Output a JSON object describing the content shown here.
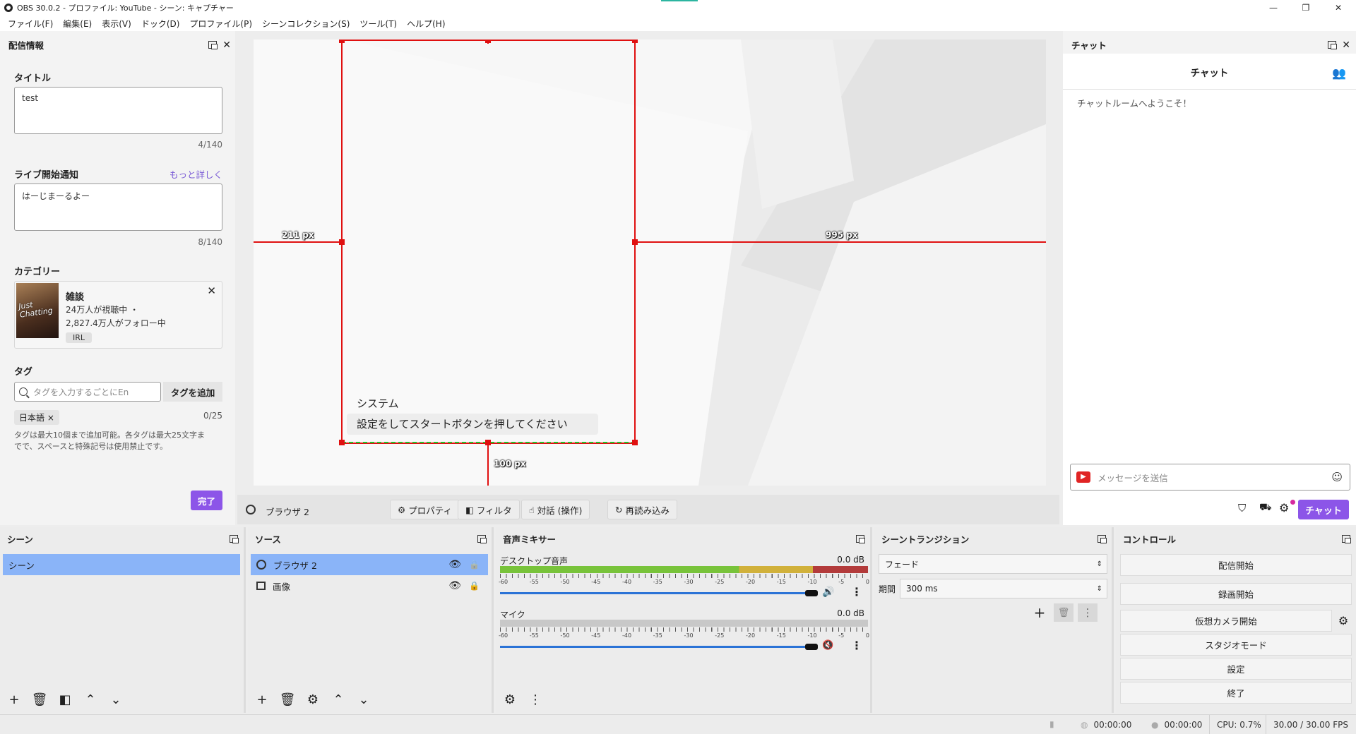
{
  "window": {
    "title": "OBS 30.0.2 - プロファイル: YouTube - シーン: キャプチャー",
    "minimize": "—",
    "maximize": "❐",
    "close": "✕"
  },
  "menu": [
    "ファイル(F)",
    "編集(E)",
    "表示(V)",
    "ドック(D)",
    "プロファイル(P)",
    "シーンコレクション(S)",
    "ツール(T)",
    "ヘルプ(H)"
  ],
  "stream_info": {
    "panel_title": "配信情報",
    "title_label": "タイトル",
    "title_value": "test",
    "title_counter": "4/140",
    "notification_label": "ライブ開始通知",
    "learn_more": "もっと詳しく",
    "notification_value": "はーじまーるよー",
    "notification_counter": "8/140",
    "category_label": "カテゴリー",
    "category": {
      "thumb_text": "Just Chatting",
      "name": "雑談",
      "viewers": "24万人が視聴中",
      "viewers_dot": "・",
      "followers": "2,827.4万人がフォロー中",
      "tag": "IRL"
    },
    "tags_label": "タグ",
    "tag_placeholder": "タグを入力するごとにEn",
    "tag_add_button": "タグを追加",
    "tag_chip": "日本語 ×",
    "tag_counter": "0/25",
    "tag_help": "タグは最大10個まで追加可能。各タグは最大25文字までで、スペースと特殊記号は使用禁止です。",
    "done_button": "完了"
  },
  "preview": {
    "label_left": "211 px",
    "label_right": "995 px",
    "label_bottom": "100 px",
    "overlay_title": "システム",
    "overlay_message": "設定をしてスタートボタンを押してください"
  },
  "source_toolbar": {
    "source_name": "ブラウザ 2",
    "properties": "プロパティ",
    "filters": "フィルタ",
    "interact": "対話 (操作)",
    "reload": "再読み込み"
  },
  "chat": {
    "panel_title": "チャット",
    "inner_title": "チャット",
    "welcome": "チャットルームへようこそ！",
    "input_placeholder": "メッセージを送信",
    "send_button": "チャット"
  },
  "scenes": {
    "title": "シーン",
    "items": [
      "シーン"
    ]
  },
  "sources": {
    "title": "ソース",
    "items": [
      {
        "name": "ブラウザ 2",
        "type": "browser",
        "selected": true
      },
      {
        "name": "画像",
        "type": "image",
        "selected": false
      }
    ]
  },
  "mixer": {
    "title": "音声ミキサー",
    "channels": [
      {
        "name": "デスクトップ音声",
        "db": "0.0 dB",
        "muted": false
      },
      {
        "name": "マイク",
        "db": "0.0 dB",
        "muted": true
      }
    ],
    "tick_labels": [
      "-60",
      "-55",
      "-50",
      "-45",
      "-40",
      "-35",
      "-30",
      "-25",
      "-20",
      "-15",
      "-10",
      "-5",
      "0"
    ]
  },
  "transitions": {
    "title": "シーントランジション",
    "selected": "フェード",
    "duration_label": "期間",
    "duration_value": "300 ms"
  },
  "controls": {
    "title": "コントロール",
    "start_streaming": "配信開始",
    "start_recording": "録画開始",
    "start_virtual_camera": "仮想カメラ開始",
    "studio_mode": "スタジオモード",
    "settings": "設定",
    "exit": "終了"
  },
  "status": {
    "stream_time": "00:00:00",
    "record_time": "00:00:00",
    "cpu": "CPU: 0.7%",
    "fps": "30.00 / 30.00 FPS"
  },
  "colors": {
    "accent_purple": "#8c55e8",
    "selection_blue": "#8ab4f8",
    "transform_red": "#e01010",
    "meter_green": "#78c33a"
  }
}
